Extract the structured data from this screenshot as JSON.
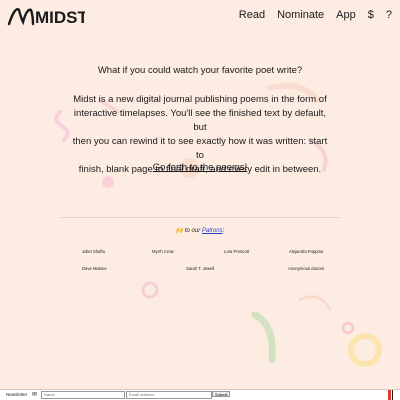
{
  "header": {
    "logo_text": "MIDST",
    "nav": [
      "Read",
      "Nominate",
      "App",
      "$",
      "?"
    ]
  },
  "main": {
    "question": "What if you could watch your favorite poet write?",
    "description_lines": [
      "Midst is a new digital journal publishing poems in the form of",
      "interactive timelapses. You'll see the finished text by default, but",
      "then you can rewind it to see exactly how it was written: start to",
      "finish, blank page to final draft, and every edit in between."
    ],
    "cta": "Go forth to the poems!"
  },
  "patrons_section": {
    "emoji": "🙌",
    "prefix": " to our ",
    "link": "Patrons",
    "suffix": ":",
    "names": [
      "Juliet Shafto",
      "Myrrh Crow",
      "Lora Prescott",
      "Alejandra Puppino",
      "Dave Malone",
      "Sarah T. Jewell",
      "Anonymous donors"
    ]
  },
  "footer": {
    "label": "Newsletter",
    "icon": "mail-icon",
    "name_placeholder": "Name",
    "email_placeholder": "Email address",
    "submit_label": "Submit"
  },
  "colors": {
    "background": "#fdece2",
    "link": "#2b3cc8",
    "accent_red": "#e0392a"
  }
}
